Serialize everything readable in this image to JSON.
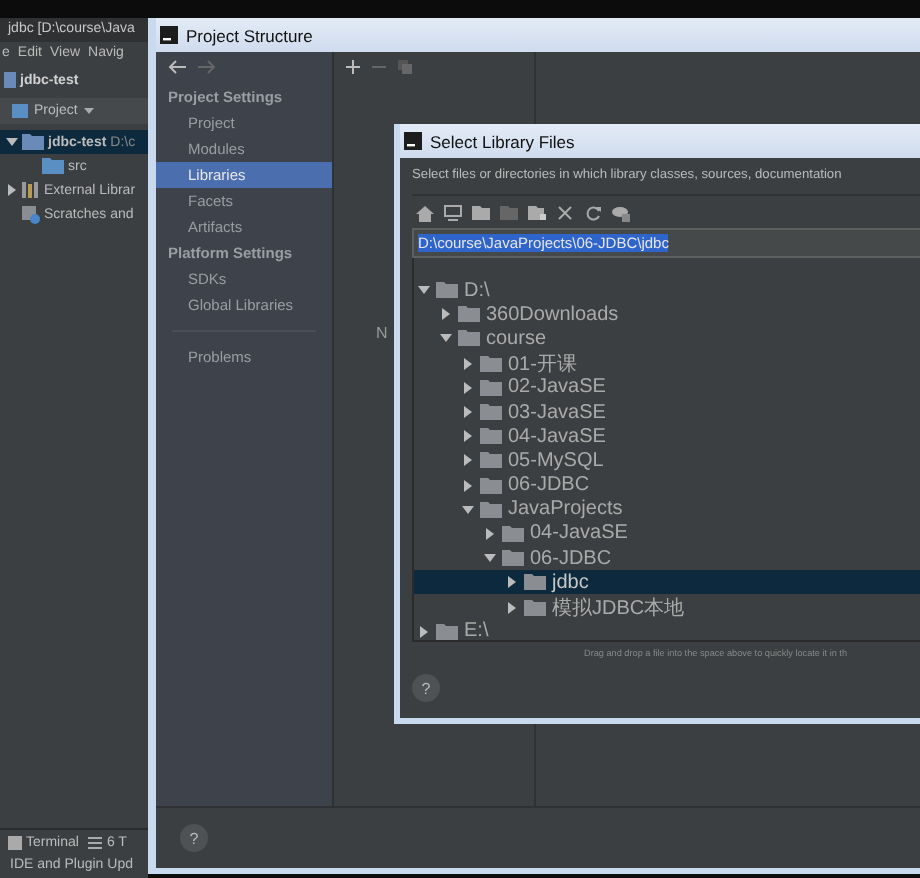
{
  "ide": {
    "title": "jdbc [D:\\course\\Java",
    "menu": [
      "e",
      "Edit",
      "View",
      "Navig"
    ],
    "breadcrumb": "jdbc-test",
    "panel_title": "Project",
    "tree": [
      {
        "label": "jdbc-test",
        "path": "D:\\c",
        "kind": "module",
        "expanded": true,
        "selected": true,
        "children": [
          {
            "label": "src",
            "kind": "source",
            "selected": false
          }
        ]
      },
      {
        "label": "External Librar",
        "kind": "libraries",
        "expanded": false,
        "selected": false
      },
      {
        "label": "Scratches and",
        "kind": "scratches",
        "selected": false
      }
    ],
    "tool_tabs": [
      {
        "label": "Terminal",
        "kind": "terminal"
      },
      {
        "label": "6 T",
        "kind": "list"
      }
    ],
    "status": "IDE and Plugin Upd"
  },
  "project_structure": {
    "title": "Project Structure",
    "sidebar": [
      {
        "kind": "header",
        "label": "Project Settings"
      },
      {
        "kind": "item",
        "label": "Project",
        "selected": false
      },
      {
        "kind": "item",
        "label": "Modules",
        "selected": false
      },
      {
        "kind": "item",
        "label": "Libraries",
        "selected": true
      },
      {
        "kind": "item",
        "label": "Facets",
        "selected": false
      },
      {
        "kind": "item",
        "label": "Artifacts",
        "selected": false
      },
      {
        "kind": "header",
        "label": "Platform Settings"
      },
      {
        "kind": "item",
        "label": "SDKs",
        "selected": false
      },
      {
        "kind": "item",
        "label": "Global Libraries",
        "selected": false
      },
      {
        "kind": "divider"
      },
      {
        "kind": "item",
        "label": "Problems",
        "selected": false
      }
    ],
    "empty_text": "N",
    "help": "?"
  },
  "dialog": {
    "title": "Select Library Files",
    "description": "Select files or directories in which library classes, sources, documentation",
    "path": "D:\\course\\JavaProjects\\06-JDBC\\jdbc",
    "tree": [
      {
        "label": "D:\\",
        "expanded": true,
        "selected": false,
        "children": [
          {
            "label": "360Downloads",
            "expanded": false,
            "selected": false
          },
          {
            "label": "course",
            "expanded": true,
            "selected": false,
            "children": [
              {
                "label": "01-开课",
                "expanded": false,
                "selected": false
              },
              {
                "label": "02-JavaSE",
                "expanded": false,
                "selected": false
              },
              {
                "label": "03-JavaSE",
                "expanded": false,
                "selected": false
              },
              {
                "label": "04-JavaSE",
                "expanded": false,
                "selected": false
              },
              {
                "label": "05-MySQL",
                "expanded": false,
                "selected": false
              },
              {
                "label": "06-JDBC",
                "expanded": false,
                "selected": false
              },
              {
                "label": "JavaProjects",
                "expanded": true,
                "selected": false,
                "children": [
                  {
                    "label": "04-JavaSE",
                    "expanded": false,
                    "selected": false
                  },
                  {
                    "label": "06-JDBC",
                    "expanded": true,
                    "selected": false,
                    "children": [
                      {
                        "label": "jdbc",
                        "expanded": false,
                        "selected": true
                      },
                      {
                        "label": "模拟JDBC本地",
                        "expanded": false,
                        "selected": false
                      }
                    ]
                  }
                ]
              }
            ]
          }
        ]
      },
      {
        "label": "E:\\",
        "expanded": false,
        "selected": false
      }
    ],
    "hint": "Drag and drop a file into the space above to quickly locate it in th",
    "help": "?"
  }
}
